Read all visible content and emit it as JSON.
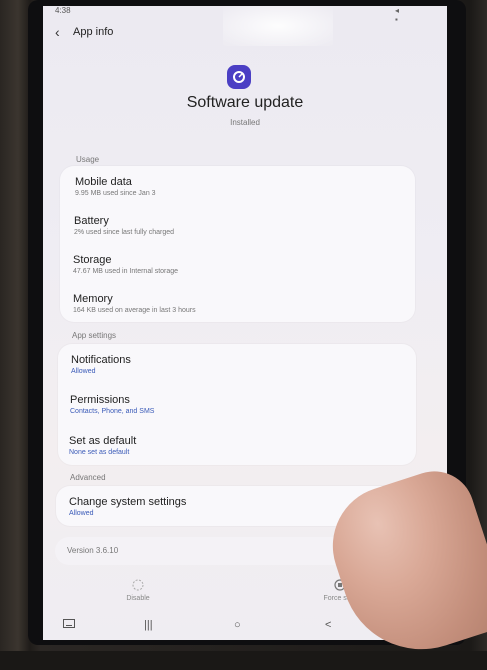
{
  "statusbar": {
    "time": "4:38",
    "right": "◂ ▪"
  },
  "header": {
    "title": "App info"
  },
  "app": {
    "name": "Software update",
    "status": "Installed"
  },
  "sections": {
    "usage": "Usage",
    "app_settings": "App settings",
    "advanced": "Advanced"
  },
  "usage": {
    "mobile_data": {
      "title": "Mobile data",
      "sub": "9.95 MB used since Jan 3"
    },
    "battery": {
      "title": "Battery",
      "sub": "2% used since last fully charged"
    },
    "storage": {
      "title": "Storage",
      "sub": "47.67 MB used in Internal storage"
    },
    "memory": {
      "title": "Memory",
      "sub": "164 KB used on average in last 3 hours"
    }
  },
  "app_settings": {
    "notifications": {
      "title": "Notifications",
      "sub": "Allowed"
    },
    "permissions": {
      "title": "Permissions",
      "sub": "Contacts, Phone, and SMS"
    },
    "default": {
      "title": "Set as default",
      "sub": "None set as default"
    }
  },
  "advanced": {
    "change_system": {
      "title": "Change system settings",
      "sub": "Allowed"
    }
  },
  "version": "Version 3.6.10",
  "actions": {
    "disable": "Disable",
    "force_stop": "Force stop"
  },
  "navbar": {
    "recents": "|||",
    "home": "○",
    "back": "<"
  },
  "colors": {
    "app_icon": "#4b3fc4",
    "link_blue": "#3b5bb8"
  },
  "icons": {
    "back": "back-arrow-icon",
    "app": "software-update-icon",
    "disable": "disable-icon",
    "force_stop": "force-stop-icon",
    "keyboard": "keyboard-icon"
  }
}
